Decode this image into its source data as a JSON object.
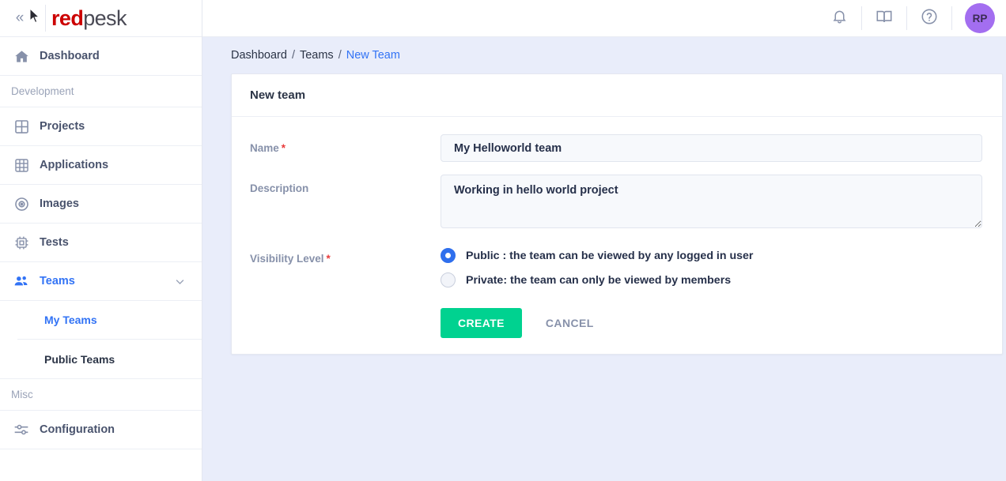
{
  "brand": {
    "name_part1": "red",
    "name_part2": "pesk",
    "collapse_glyph": "«"
  },
  "sidebar": {
    "dashboard": {
      "label": "Dashboard",
      "icon": "home-icon"
    },
    "section_development": "Development",
    "items": [
      {
        "label": "Projects",
        "icon": "grid-4-icon"
      },
      {
        "label": "Applications",
        "icon": "grid-9-icon"
      },
      {
        "label": "Images",
        "icon": "disc-icon"
      },
      {
        "label": "Tests",
        "icon": "chip-icon"
      }
    ],
    "teams": {
      "label": "Teams",
      "icon": "users-icon",
      "chevron": "chevron-down-icon"
    },
    "teams_children": [
      {
        "label": "My Teams",
        "active": true
      },
      {
        "label": "Public Teams",
        "active": false
      }
    ],
    "section_misc": "Misc",
    "configuration": {
      "label": "Configuration",
      "icon": "sliders-icon"
    }
  },
  "topbar": {
    "notifications_icon": "bell-icon",
    "docs_icon": "book-icon",
    "help_icon": "question-circle-icon",
    "avatar_initials": "RP"
  },
  "breadcrumb": {
    "item1": "Dashboard",
    "item2": "Teams",
    "current": "New Team",
    "separator": "/"
  },
  "card": {
    "title": "New team",
    "name": {
      "label": "Name",
      "required_mark": "*",
      "value": "My Helloworld team",
      "placeholder": ""
    },
    "description": {
      "label": "Description",
      "value": "Working in hello world project",
      "placeholder": ""
    },
    "visibility": {
      "label": "Visibility Level",
      "required_mark": "*",
      "options": [
        {
          "label": "Public : the team can be viewed by any logged in user",
          "selected": true
        },
        {
          "label": "Private: the team can only be viewed by members",
          "selected": false
        }
      ]
    },
    "create_button": "CREATE",
    "cancel_button": "CANCEL"
  },
  "colors": {
    "brand_red": "#cc0000",
    "accent_blue": "#3273f5",
    "success_green": "#00d290",
    "page_bg": "#e9edfa",
    "avatar_purple": "#a36ef0",
    "required_red": "#e83b3b"
  }
}
